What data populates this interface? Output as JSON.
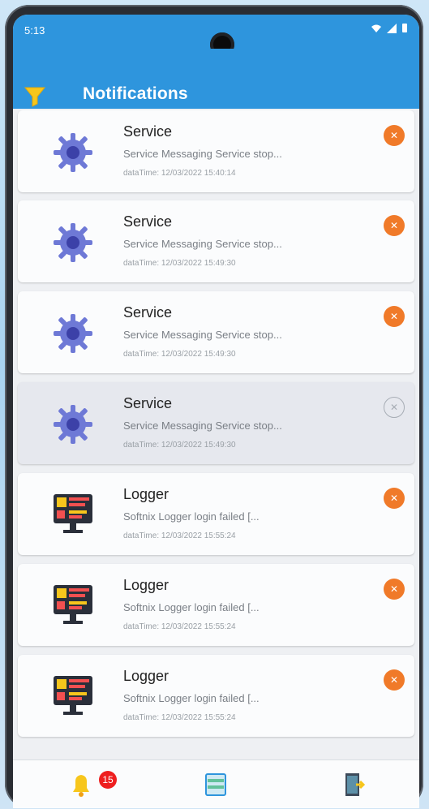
{
  "status_bar": {
    "time": "5:13"
  },
  "header": {
    "title": "Notifications"
  },
  "notifications": [
    {
      "title": "Service",
      "description": "Service Messaging Service stop...",
      "date": "dataTime: 12/03/2022 15:40:14",
      "type": "service",
      "selected": false
    },
    {
      "title": "Service",
      "description": "Service Messaging Service stop...",
      "date": "dataTime: 12/03/2022 15:49:30",
      "type": "service",
      "selected": false
    },
    {
      "title": "Service",
      "description": "Service Messaging Service stop...",
      "date": "dataTime: 12/03/2022 15:49:30",
      "type": "service",
      "selected": false
    },
    {
      "title": "Service",
      "description": "Service Messaging Service stop...",
      "date": "dataTime: 12/03/2022 15:49:30",
      "type": "service",
      "selected": true
    },
    {
      "title": "Logger",
      "description": "Softnix Logger login failed [...",
      "date": "dataTime: 12/03/2022 15:55:24",
      "type": "logger",
      "selected": false
    },
    {
      "title": "Logger",
      "description": "Softnix Logger login failed [...",
      "date": "dataTime: 12/03/2022 15:55:24",
      "type": "logger",
      "selected": false
    },
    {
      "title": "Logger",
      "description": "Softnix Logger login failed [...",
      "date": "dataTime: 12/03/2022 15:55:24",
      "type": "logger",
      "selected": false
    }
  ],
  "close_glyph": "✕",
  "bottom_nav": {
    "badge_count": "15"
  },
  "colors": {
    "primary": "#2e95dd",
    "accent": "#f07a29",
    "badge": "#ee1f1f"
  }
}
